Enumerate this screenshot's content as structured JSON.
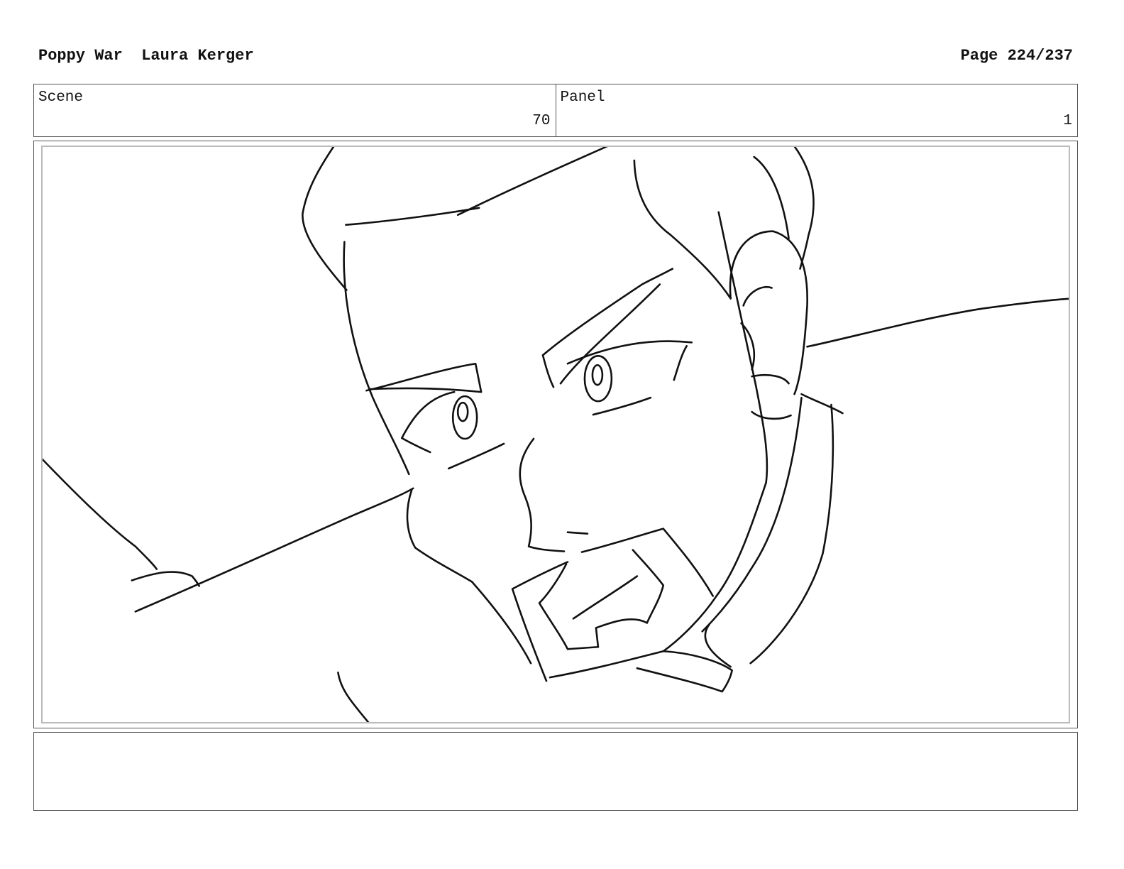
{
  "header": {
    "project": "Poppy War",
    "artist": "Laura Kerger",
    "page_label": "Page 224/237"
  },
  "scene": {
    "label": "Scene",
    "value": "70"
  },
  "panel": {
    "label": "Panel",
    "value": "1"
  },
  "drawing": {
    "description_icon": "storyboard-sketch-face-icon"
  },
  "notes": {
    "text": ""
  }
}
